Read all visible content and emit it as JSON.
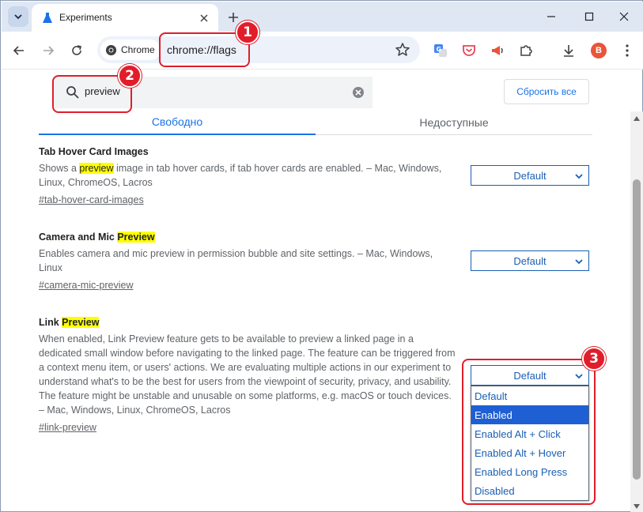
{
  "window": {
    "tab_title": "Experiments"
  },
  "toolbar": {
    "chip_label": "Chrome",
    "url": "chrome://flags",
    "avatar_letter": "B"
  },
  "search": {
    "value": "preview"
  },
  "header": {
    "reset_label": "Сбросить все"
  },
  "tabs": [
    {
      "label": "Свободно"
    },
    {
      "label": "Недоступные"
    }
  ],
  "experiments": [
    {
      "title_pre": "Tab Hover Card Images",
      "title_hl": "",
      "desc_pre": "Shows a ",
      "desc_hl": "preview",
      "desc_post": " image in tab hover cards, if tab hover cards are enabled. – Mac, Windows, Linux, ChromeOS, Lacros",
      "link": "#tab-hover-card-images",
      "selected": "Default"
    },
    {
      "title_pre": "Camera and Mic ",
      "title_hl": "Preview",
      "desc_pre": "Enables camera and mic preview in permission bubble and site settings. – Mac, Windows, Linux",
      "desc_hl": "",
      "desc_post": "",
      "link": "#camera-mic-preview",
      "selected": "Default"
    },
    {
      "title_pre": "Link ",
      "title_hl": "Preview",
      "desc_pre": "When enabled, Link Preview feature gets to be available to preview a linked page in a dedicated small window before navigating to the linked page. The feature can be triggered from a context menu item, or users' actions. We are evaluating multiple actions in our experiment to understand what's to be the best for users from the viewpoint of security, privacy, and usability. The feature might be unstable and unusable on some platforms, e.g. macOS or touch devices. – Mac, Windows, Linux, ChromeOS, Lacros",
      "desc_hl": "",
      "desc_post": "",
      "link": "#link-preview",
      "selected": "Default"
    }
  ],
  "dropdown": {
    "options": [
      "Default",
      "Enabled",
      "Enabled Alt + Click",
      "Enabled Alt + Hover",
      "Enabled Long Press",
      "Disabled"
    ],
    "highlighted_index": 1
  },
  "badges": [
    "1",
    "2",
    "3"
  ],
  "colors": {
    "accent": "#1a73e8",
    "annotation": "#e11d2a",
    "highlight": "#ffff00",
    "select_text": "#1a5fb4"
  },
  "icons": [
    "tab-search-icon",
    "flask-icon",
    "close-icon",
    "plus-icon",
    "minimize-icon",
    "maximize-icon",
    "back-icon",
    "forward-icon",
    "reload-icon",
    "chrome-logo-icon",
    "star-icon",
    "translate-icon",
    "pocket-icon",
    "megaphone-icon",
    "puzzle-icon",
    "download-icon",
    "kebab-menu-icon",
    "search-icon",
    "clear-icon",
    "chevron-down-icon"
  ]
}
